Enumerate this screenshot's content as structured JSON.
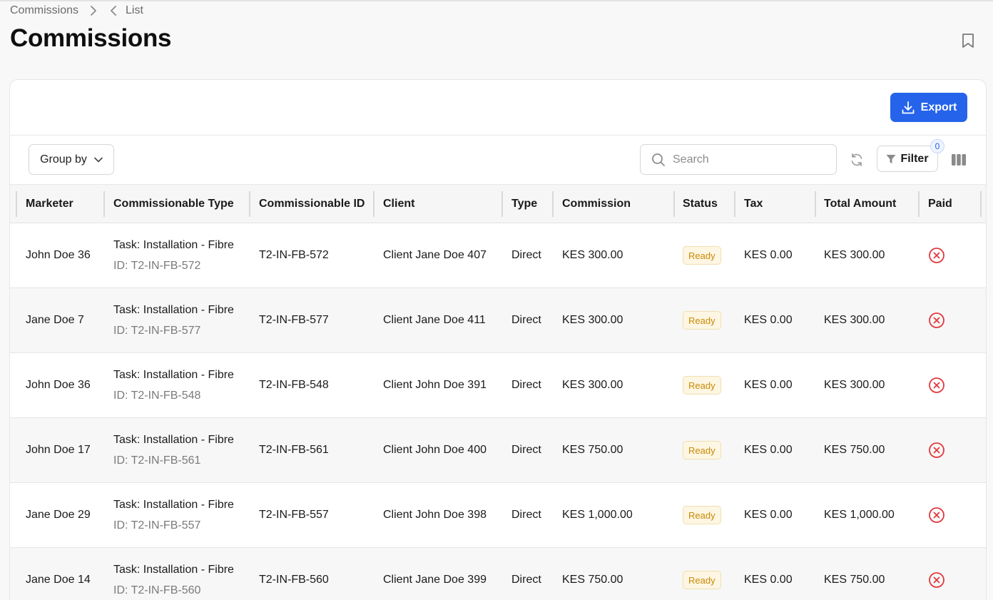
{
  "breadcrumb": {
    "root": "Commissions",
    "current": "List"
  },
  "page": {
    "title": "Commissions"
  },
  "actions": {
    "export_label": "Export"
  },
  "toolbar": {
    "group_by_label": "Group by",
    "search_placeholder": "Search",
    "search_value": "",
    "filter_label": "Filter",
    "filter_count": "0"
  },
  "colors": {
    "accent": "#2563eb",
    "status_ready_text": "#c98a06",
    "status_ready_bg": "#fdf6e3",
    "unpaid_icon": "#e0393e"
  },
  "table": {
    "columns": [
      "Marketer",
      "Commissionable Type",
      "Commissionable ID",
      "Client",
      "Type",
      "Commission",
      "Status",
      "Tax",
      "Total Amount",
      "Paid"
    ],
    "rows": [
      {
        "marketer": "John Doe 36",
        "ctype": "Task: Installation - Fibre",
        "ctype_id": "ID: T2-IN-FB-572",
        "cid": "T2-IN-FB-572",
        "client": "Client Jane Doe 407",
        "type": "Direct",
        "commission": "KES 300.00",
        "status": "Ready",
        "tax": "KES 0.00",
        "total": "KES 300.00",
        "paid": "not-paid-icon"
      },
      {
        "marketer": "Jane Doe 7",
        "ctype": "Task: Installation - Fibre",
        "ctype_id": "ID: T2-IN-FB-577",
        "cid": "T2-IN-FB-577",
        "client": "Client Jane Doe 411",
        "type": "Direct",
        "commission": "KES 300.00",
        "status": "Ready",
        "tax": "KES 0.00",
        "total": "KES 300.00",
        "paid": "not-paid-icon"
      },
      {
        "marketer": "John Doe 36",
        "ctype": "Task: Installation - Fibre",
        "ctype_id": "ID: T2-IN-FB-548",
        "cid": "T2-IN-FB-548",
        "client": "Client John Doe 391",
        "type": "Direct",
        "commission": "KES 300.00",
        "status": "Ready",
        "tax": "KES 0.00",
        "total": "KES 300.00",
        "paid": "not-paid-icon"
      },
      {
        "marketer": "John Doe 17",
        "ctype": "Task: Installation - Fibre",
        "ctype_id": "ID: T2-IN-FB-561",
        "cid": "T2-IN-FB-561",
        "client": "Client John Doe 400",
        "type": "Direct",
        "commission": "KES 750.00",
        "status": "Ready",
        "tax": "KES 0.00",
        "total": "KES 750.00",
        "paid": "not-paid-icon"
      },
      {
        "marketer": "Jane Doe 29",
        "ctype": "Task: Installation - Fibre",
        "ctype_id": "ID: T2-IN-FB-557",
        "cid": "T2-IN-FB-557",
        "client": "Client John Doe 398",
        "type": "Direct",
        "commission": "KES 1,000.00",
        "status": "Ready",
        "tax": "KES 0.00",
        "total": "KES 1,000.00",
        "paid": "not-paid-icon"
      },
      {
        "marketer": "Jane Doe 14",
        "ctype": "Task: Installation - Fibre",
        "ctype_id": "ID: T2-IN-FB-560",
        "cid": "T2-IN-FB-560",
        "client": "Client Jane Doe 399",
        "type": "Direct",
        "commission": "KES 750.00",
        "status": "Ready",
        "tax": "KES 0.00",
        "total": "KES 750.00",
        "paid": "not-paid-icon"
      }
    ]
  }
}
